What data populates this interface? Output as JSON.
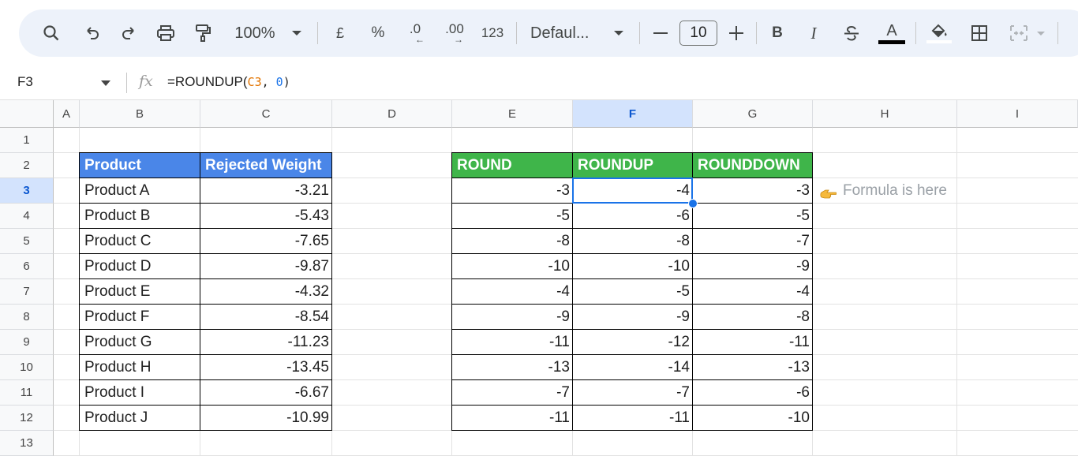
{
  "toolbar": {
    "zoom": "100%",
    "currency": "£",
    "percent": "%",
    "decrease_decimal": ".0",
    "increase_decimal": ".00",
    "number_format": "123",
    "font": "Defaul...",
    "font_size": "10",
    "bold": "B",
    "italic": "I",
    "text_color": "A"
  },
  "formula_bar": {
    "name_box": "F3",
    "fx": "fx",
    "formula_prefix": "=ROUNDUP(",
    "formula_ref": "C3",
    "formula_sep": ", ",
    "formula_num": "0",
    "formula_suffix": ")"
  },
  "columns": [
    "A",
    "B",
    "C",
    "D",
    "E",
    "F",
    "G",
    "H",
    "I"
  ],
  "rows": [
    "1",
    "2",
    "3",
    "4",
    "5",
    "6",
    "7",
    "8",
    "9",
    "10",
    "11",
    "12",
    "13"
  ],
  "table1": {
    "headers": [
      "Product",
      "Rejected Weight"
    ],
    "rows": [
      [
        "Product A",
        "-3.21"
      ],
      [
        "Product B",
        "-5.43"
      ],
      [
        "Product C",
        "-7.65"
      ],
      [
        "Product D",
        "-9.87"
      ],
      [
        "Product E",
        "-4.32"
      ],
      [
        "Product F",
        "-8.54"
      ],
      [
        "Product G",
        "-11.23"
      ],
      [
        "Product H",
        "-13.45"
      ],
      [
        "Product I",
        "-6.67"
      ],
      [
        "Product J",
        "-10.99"
      ]
    ]
  },
  "table2": {
    "headers": [
      "ROUND",
      "ROUNDUP",
      "ROUNDDOWN"
    ],
    "rows": [
      [
        "-3",
        "-4",
        "-3"
      ],
      [
        "-5",
        "-6",
        "-5"
      ],
      [
        "-8",
        "-8",
        "-7"
      ],
      [
        "-10",
        "-10",
        "-9"
      ],
      [
        "-4",
        "-5",
        "-4"
      ],
      [
        "-9",
        "-9",
        "-8"
      ],
      [
        "-11",
        "-12",
        "-11"
      ],
      [
        "-13",
        "-14",
        "-13"
      ],
      [
        "-7",
        "-7",
        "-6"
      ],
      [
        "-11",
        "-11",
        "-10"
      ]
    ]
  },
  "note": "Formula is here",
  "colors": {
    "blue_header": "#4a86e8",
    "green_header": "#3fb54a",
    "selection": "#1a73e8"
  }
}
